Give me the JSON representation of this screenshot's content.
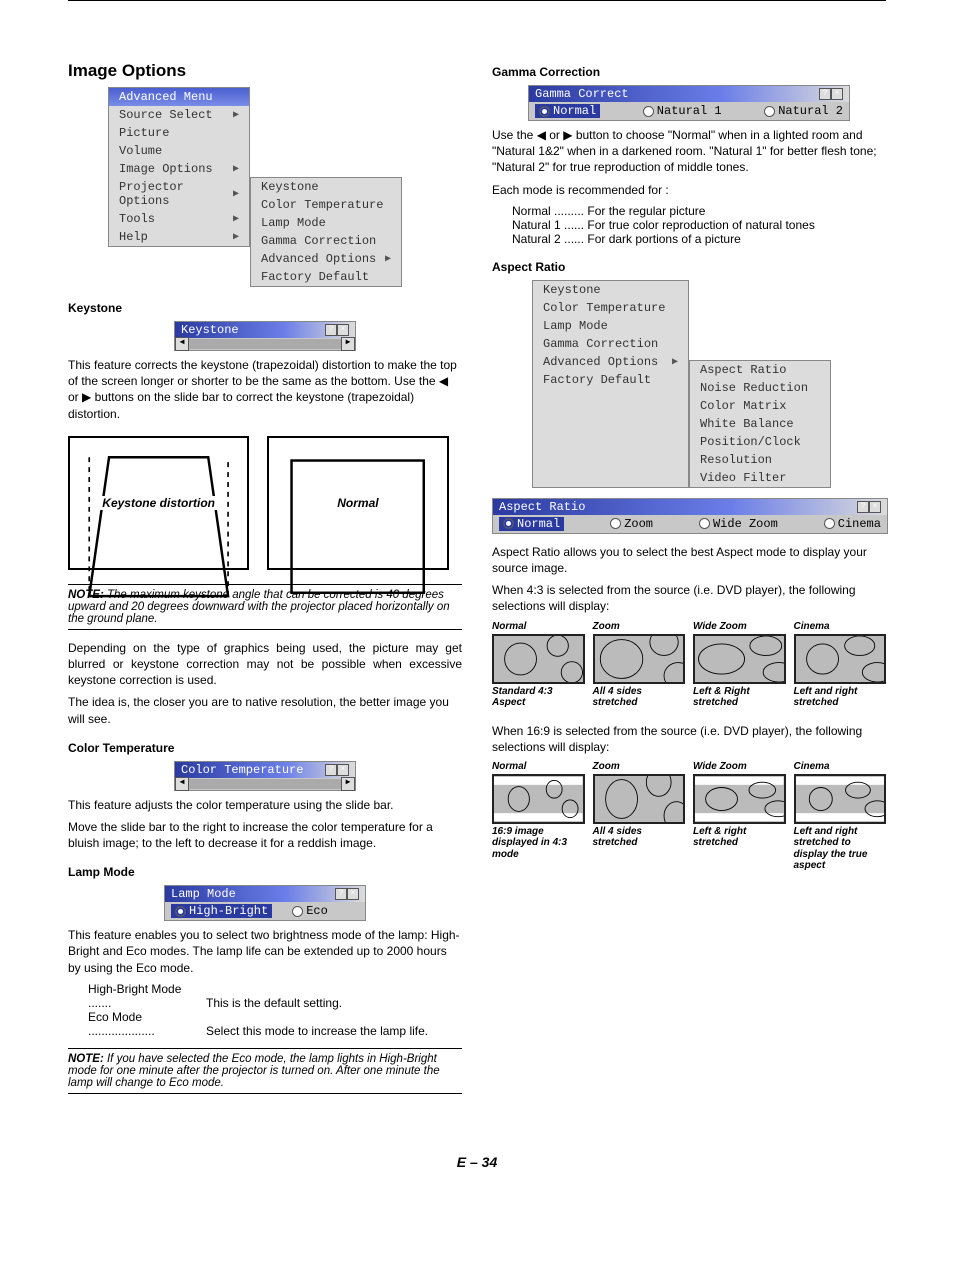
{
  "left": {
    "title": "Image Options",
    "main_menu": {
      "selected": "Advanced Menu",
      "items": [
        "Source Select",
        "Picture",
        "Volume",
        "Image Options",
        "Projector Options",
        "Tools",
        "Help"
      ],
      "arrows": [
        true,
        false,
        false,
        true,
        true,
        true,
        true
      ]
    },
    "submenu": [
      "Keystone",
      "Color Temperature",
      "Lamp Mode",
      "Gamma Correction",
      "Advanced Options",
      "Factory Default"
    ],
    "submenu_arrow_idx": 4,
    "keystone": {
      "heading": "Keystone",
      "dlg_title": "Keystone",
      "desc": "This feature corrects the keystone (trapezoidal) distortion to make the top of the screen longer or shorter to be the same as the bottom. Use the ◀ or ▶ buttons on the slide bar to correct the keystone (trapezoidal) distortion.",
      "box1": "Keystone distortion",
      "box2": "Normal",
      "note": "NOTE: The maximum keystone angle that can be corrected is 40 degrees upward and 20 degrees downward with the projector placed horizontally on the ground plane.",
      "p2": "Depending on the type of graphics being used, the picture may get blurred or keystone correction may not be possible when excessive keystone correction is used.",
      "p3": "The idea is, the closer you are to native resolution, the better image you will see."
    },
    "coltemp": {
      "heading": "Color Temperature",
      "dlg_title": "Color Temperature",
      "desc": "This feature adjusts the color temperature using the slide bar.",
      "p2": "Move the slide bar to the right to increase the color temperature for a bluish image; to the left to decrease it for a reddish image."
    },
    "lamp": {
      "heading": "Lamp Mode",
      "dlg_title": "Lamp Mode",
      "opt1": "High-Bright",
      "opt2": "Eco",
      "desc": "This feature enables you to select two brightness mode of the lamp: High-Bright and Eco modes. The lamp life can be extended up to 2000 hours by using the Eco mode.",
      "modes": [
        {
          "k": "High-Bright Mode .......",
          "v": "This is the default setting."
        },
        {
          "k": "Eco Mode ....................",
          "v": "Select this mode to increase the lamp life."
        }
      ],
      "note": "NOTE: If you have selected the Eco mode, the lamp lights in High-Bright mode for one minute after the projector is turned on. After one minute the lamp will change to Eco mode."
    }
  },
  "right": {
    "gamma": {
      "heading": "Gamma Correction",
      "dlg_title": "Gamma Correct",
      "opts": [
        "Normal",
        "Natural 1",
        "Natural 2"
      ],
      "desc": "Use the ◀ or ▶ button to choose \"Normal\" when in a lighted room and \"Natural 1&2\" when in a darkened room. \"Natural 1\" for better flesh tone; \"Natural 2\" for true reproduction of middle tones.",
      "desc2": "Each mode is recommended for :",
      "modes": [
        {
          "k": "Normal .........",
          "v": "For the regular picture"
        },
        {
          "k": "Natural 1 ......",
          "v": "For true color reproduction of natural tones"
        },
        {
          "k": "Natural 2 ......",
          "v": "For dark portions of a picture"
        }
      ]
    },
    "aspect": {
      "heading": "Aspect Ratio",
      "menu1": [
        "Keystone",
        "Color Temperature",
        "Lamp Mode",
        "Gamma Correction",
        "Advanced Options",
        "Factory Default"
      ],
      "menu1_arrow_idx": 4,
      "menu2": [
        "Aspect Ratio",
        "Noise Reduction",
        "Color Matrix",
        "White Balance",
        "Position/Clock",
        "Resolution",
        "Video Filter"
      ],
      "dlg_title": "Aspect Ratio",
      "opts": [
        "Normal",
        "Zoom",
        "Wide Zoom",
        "Cinema"
      ],
      "p1": "Aspect Ratio allows you to select the best Aspect mode to display your source image.",
      "p2": "When 4:3 is selected from the source (i.e. DVD player), the following selections will display:",
      "row43": [
        {
          "top": "Normal",
          "bot": "Standard 4:3 Aspect"
        },
        {
          "top": "Zoom",
          "bot": "All 4 sides stretched"
        },
        {
          "top": "Wide Zoom",
          "bot": "Left & Right stretched"
        },
        {
          "top": "Cinema",
          "bot": "Left and right stretched"
        }
      ],
      "p3": "When 16:9 is selected from the source (i.e. DVD player), the following selections will display:",
      "row169": [
        {
          "top": "Normal",
          "bot": "16:9 image displayed in 4:3 mode"
        },
        {
          "top": "Zoom",
          "bot": "All 4 sides stretched"
        },
        {
          "top": "Wide Zoom",
          "bot": "Left & right stretched"
        },
        {
          "top": "Cinema",
          "bot": "Left and right stretched to display the true aspect"
        }
      ]
    }
  },
  "footer": "E – 34"
}
